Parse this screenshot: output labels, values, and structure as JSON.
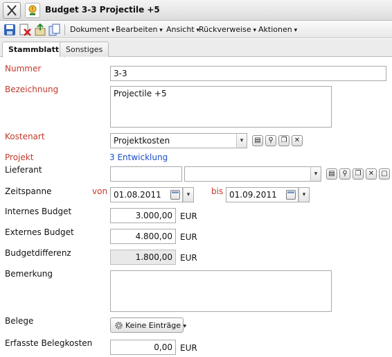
{
  "window": {
    "title": "Budget 3-3 Projectile +5"
  },
  "toolbar": {
    "icons": [
      "save-icon",
      "delete-icon",
      "export-icon",
      "copy-icon"
    ],
    "menus": [
      "Dokument",
      "Bearbeiten",
      "Ansicht",
      "Rückverweise",
      "Aktionen"
    ]
  },
  "tabs": [
    {
      "label": "Stammblatt",
      "active": true
    },
    {
      "label": "Sonstiges",
      "active": false
    }
  ],
  "form": {
    "nummer": {
      "label": "Nummer",
      "value": "3-3"
    },
    "bezeichnung": {
      "label": "Bezeichnung",
      "value": "Projectile +5"
    },
    "kostenart": {
      "label": "Kostenart",
      "value": "Projektkosten"
    },
    "projekt": {
      "label": "Projekt",
      "value": "3 Entwicklung"
    },
    "lieferant": {
      "label": "Lieferant",
      "value1": "",
      "value2": ""
    },
    "zeitspanne": {
      "label": "Zeitspanne",
      "von_label": "von",
      "von": "01.08.2011",
      "bis_label": "bis",
      "bis": "01.09.2011"
    },
    "internes_budget": {
      "label": "Internes Budget",
      "value": "3.000,00",
      "unit": "EUR"
    },
    "externes_budget": {
      "label": "Externes Budget",
      "value": "4.800,00",
      "unit": "EUR"
    },
    "budgetdifferenz": {
      "label": "Budgetdifferenz",
      "value": "1.800,00",
      "unit": "EUR"
    },
    "bemerkung": {
      "label": "Bemerkung",
      "value": ""
    },
    "belege": {
      "label": "Belege",
      "button": "Keine Einträge"
    },
    "erfasste_belegkosten": {
      "label": "Erfasste Belegkosten",
      "value": "0,00",
      "unit": "EUR"
    }
  },
  "colors": {
    "required_label": "#c0392b",
    "link": "#1a4fc4"
  }
}
